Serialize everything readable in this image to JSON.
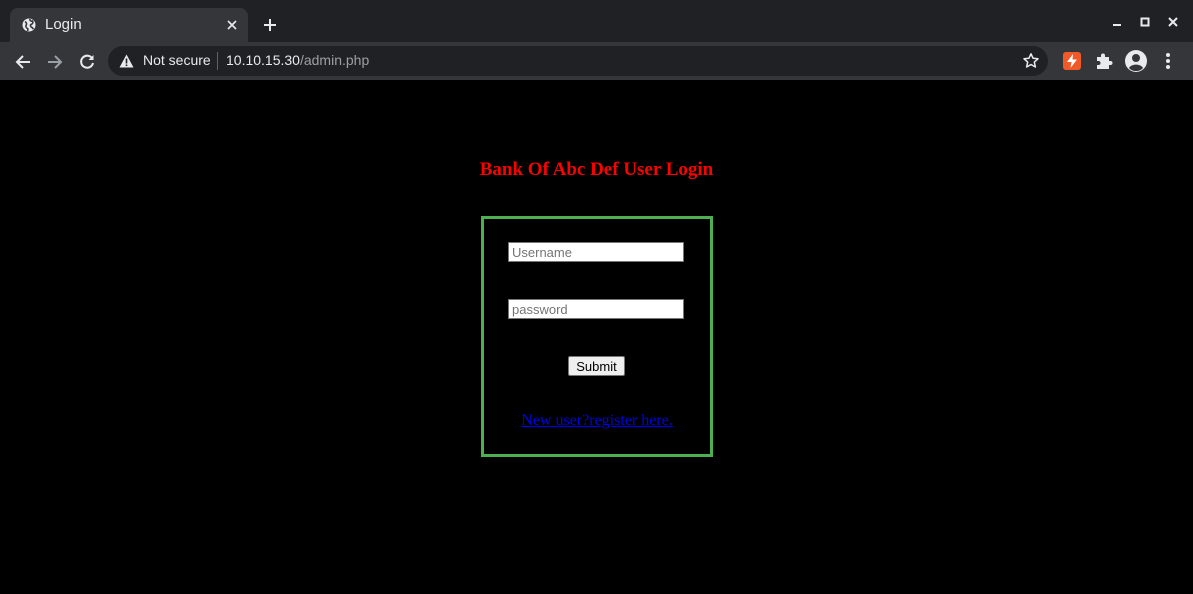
{
  "browser": {
    "tab_title": "Login",
    "security_label": "Not secure",
    "url_host": "10.10.15.30",
    "url_path": "/admin.php",
    "icons": [
      "globe-icon",
      "close-icon",
      "plus-icon",
      "minimize-icon",
      "maximize-icon",
      "window-close-icon",
      "back-icon",
      "forward-icon",
      "reload-icon",
      "warning-icon",
      "star-icon",
      "extension-icon",
      "puzzle-icon",
      "profile-icon",
      "menu-icon"
    ]
  },
  "page": {
    "heading": "Bank Of Abc Def User Login",
    "username_placeholder": "Username",
    "password_placeholder": "password",
    "submit_label": "Submit",
    "register_link": "New user?register here."
  },
  "colors": {
    "heading": "#ff0000",
    "box_border": "#4caf50",
    "link": "#0000ee",
    "background": "#000000"
  }
}
